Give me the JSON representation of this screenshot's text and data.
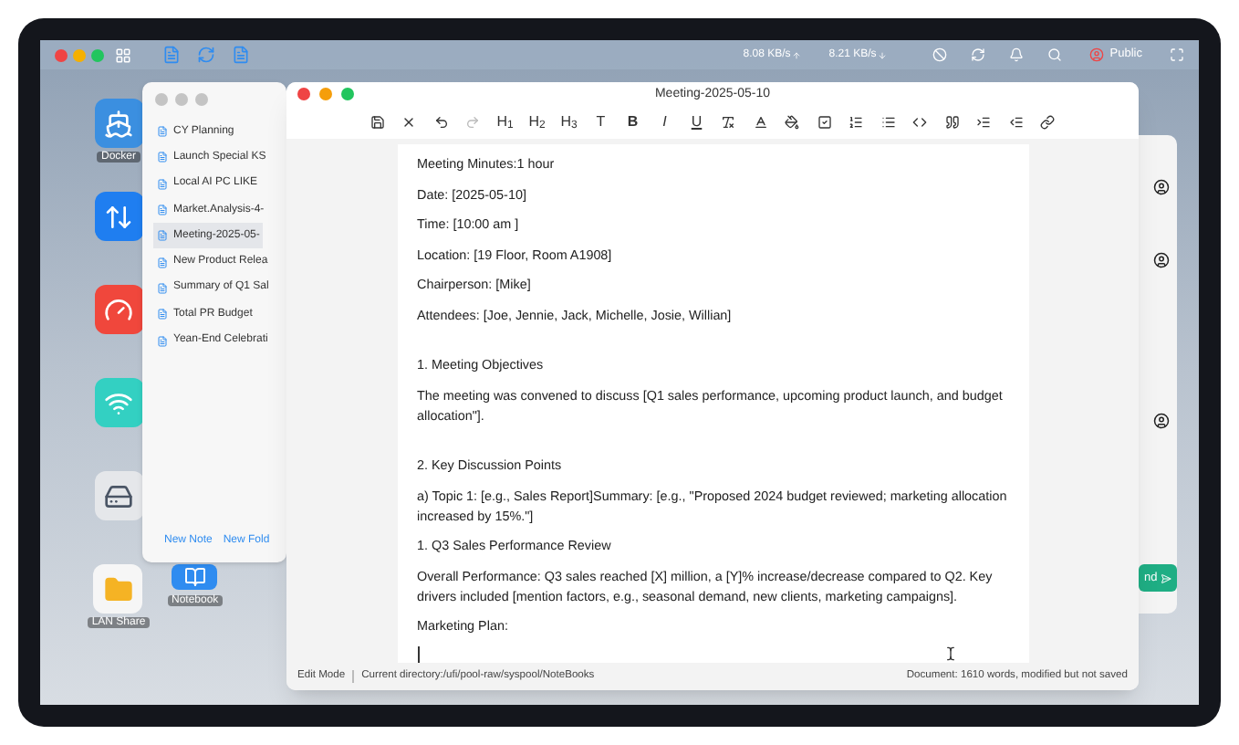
{
  "menu_bar": {
    "speeds": [
      {
        "text": "8.08 KB/s",
        "kind": "up"
      },
      {
        "text": "8.21 KB/s",
        "kind": "down"
      }
    ],
    "profile": "Public"
  },
  "desktop_icons": [
    {
      "kind": "docker",
      "label": "Docker"
    },
    {
      "kind": "sync"
    },
    {
      "kind": "speed"
    },
    {
      "kind": "network"
    },
    {
      "kind": "disk"
    },
    {
      "kind": "folder",
      "label": "LAN Share"
    }
  ],
  "notebook_shortcut": {
    "label": "Notebook"
  },
  "notes_window": {
    "notes": [
      {
        "title": "CY Planning",
        "selected": false
      },
      {
        "title": "Launch Special KS",
        "selected": false
      },
      {
        "title": "Local AI PC LIKE",
        "selected": false
      },
      {
        "title": "Market.Analysis-4-",
        "selected": false
      },
      {
        "title": "Meeting-2025-05-",
        "selected": true
      },
      {
        "title": "New Product Relea",
        "selected": false
      },
      {
        "title": "Summary of Q1 Sal",
        "selected": false
      },
      {
        "title": "Total PR Budget",
        "selected": false
      },
      {
        "title": "Yean-End Celebrati",
        "selected": false
      }
    ],
    "buttons": [
      "New Note",
      "New Fold"
    ]
  },
  "editor": {
    "title": "Meeting-2025-05-10",
    "toolbar": [
      {
        "kind": "save"
      },
      {
        "kind": "close"
      },
      {
        "kind": "undo",
        "disabled": false
      },
      {
        "kind": "redo",
        "disabled": true
      },
      {
        "kind": "text",
        "label": "H$_{1}$"
      },
      {
        "kind": "text",
        "label": "H$_{2}$"
      },
      {
        "kind": "text",
        "label": "H$_{3}$"
      },
      {
        "kind": "text",
        "label": "T"
      },
      {
        "kind": "bold",
        "label": "B"
      },
      {
        "kind": "italic",
        "label": "I"
      },
      {
        "kind": "underline",
        "label": "U"
      },
      {
        "kind": "clear"
      },
      {
        "kind": "color"
      },
      {
        "kind": "highlight"
      },
      {
        "kind": "checkbox"
      },
      {
        "kind": "ordered"
      },
      {
        "kind": "bullets"
      },
      {
        "kind": "code"
      },
      {
        "kind": "quote"
      },
      {
        "kind": "indent"
      },
      {
        "kind": "outdent"
      },
      {
        "kind": "link"
      }
    ],
    "lines": [
      {
        "kind": "text",
        "text": "Meeting Minutes:1 hour"
      },
      {
        "kind": "text",
        "text": "Date: [2025-05-10]"
      },
      {
        "kind": "text",
        "text": "Time: [10:00 am ]"
      },
      {
        "kind": "text",
        "text": "Location: [19 Floor, Room A1908]"
      },
      {
        "kind": "text",
        "text": "Chairperson: [Mike]"
      },
      {
        "kind": "text",
        "text": "Attendees: [Joe, Jennie, Jack, Michelle, Josie, Willian]"
      },
      {
        "kind": "blank"
      },
      {
        "kind": "text",
        "text": "1. Meeting Objectives"
      },
      {
        "kind": "text",
        "text": "The meeting was convened to discuss [Q1 sales performance, upcoming product launch, and budget allocation\"]."
      },
      {
        "kind": "blank"
      },
      {
        "kind": "text",
        "text": "2. Key Discussion Points"
      },
      {
        "kind": "text",
        "text": "a) Topic 1: [e.g., Sales Report]Summary: [e.g., \"Proposed 2024 budget reviewed; marketing allocation increased by 15%.\"]"
      },
      {
        "kind": "text",
        "text": "1. Q3 Sales Performance Review"
      },
      {
        "kind": "text",
        "text": "Overall Performance: Q3 sales reached [X] million, a [Y]% increase/decrease compared to Q2. Key drivers included [mention factors, e.g., seasonal demand, new clients, marketing campaigns]."
      },
      {
        "kind": "text",
        "text": "Marketing Plan:"
      },
      {
        "kind": "cursor"
      }
    ],
    "status_bar": {
      "mode": "Edit Mode",
      "directory": "Current directory:/ufi/pool-raw/syspool/NoteBooks",
      "document": "Document: 1610 words, modified but not saved"
    }
  },
  "chat_window": {
    "send_button": "nd"
  }
}
